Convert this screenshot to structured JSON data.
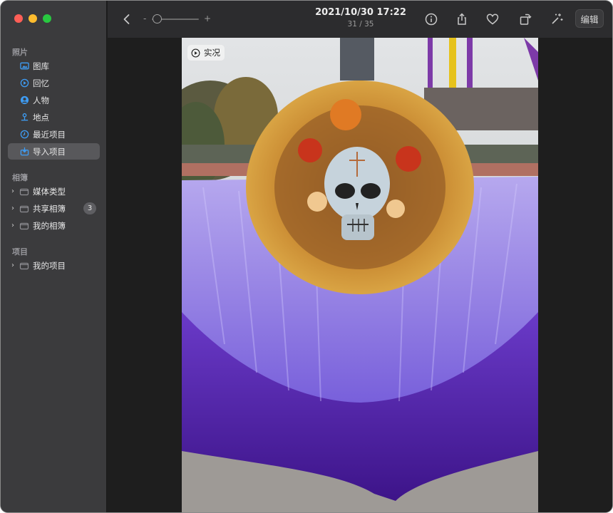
{
  "window": {
    "accent": "#58585b"
  },
  "sidebar": {
    "sections": [
      {
        "title": "照片"
      },
      {
        "title": "相簿"
      },
      {
        "title": "项目"
      }
    ],
    "photos": [
      {
        "label": "图库",
        "icon": "photos-library-icon"
      },
      {
        "label": "回忆",
        "icon": "memories-icon"
      },
      {
        "label": "人物",
        "icon": "people-icon"
      },
      {
        "label": "地点",
        "icon": "places-icon"
      },
      {
        "label": "最近项目",
        "icon": "recents-icon"
      },
      {
        "label": "导入项目",
        "icon": "imports-icon",
        "selected": true
      }
    ],
    "albums": [
      {
        "label": "媒体类型"
      },
      {
        "label": "共享相簿",
        "badge": "3"
      },
      {
        "label": "我的相簿"
      }
    ],
    "projects": [
      {
        "label": "我的项目"
      }
    ]
  },
  "toolbar": {
    "title": "2021/10/30 17:22",
    "subtitle": "31 / 35",
    "zoom_minus": "-",
    "zoom_plus": "+",
    "edit_label": "编辑"
  },
  "photo": {
    "live_label": "实况"
  }
}
